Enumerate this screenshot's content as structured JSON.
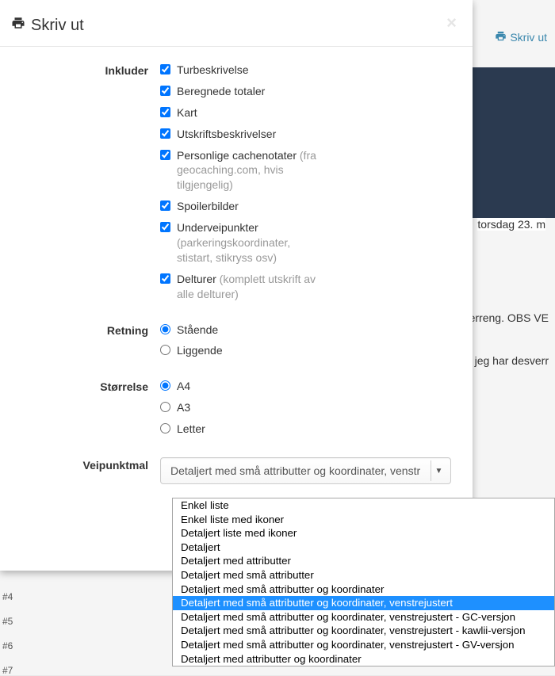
{
  "modal": {
    "title": "Skriv ut",
    "close": "×"
  },
  "background": {
    "print_link": "Skriv ut",
    "date": "torsdag 23. m",
    "text1": "terreng. OBS VE",
    "text2": ", jeg har desverr",
    "rows": [
      "#4",
      "#5",
      "#6",
      "#7"
    ]
  },
  "sections": {
    "include": {
      "label": "Inkluder",
      "items": [
        {
          "label": "Turbeskrivelse",
          "checked": true
        },
        {
          "label": "Beregnede totaler",
          "checked": true
        },
        {
          "label": "Kart",
          "checked": true
        },
        {
          "label": "Utskriftsbeskrivelser",
          "checked": true
        },
        {
          "label": "Personlige cachenotater",
          "hint": " (fra geocaching.com, hvis tilgjengelig)",
          "checked": true
        },
        {
          "label": "Spoilerbilder",
          "checked": true
        },
        {
          "label": "Underveipunkter",
          "hint": " (parkeringskoordinater, stistart, stikryss osv)",
          "checked": true
        },
        {
          "label": "Delturer",
          "hint": " (komplett utskrift av alle delturer)",
          "checked": true
        }
      ]
    },
    "orientation": {
      "label": "Retning",
      "items": [
        {
          "label": "Stående",
          "checked": true
        },
        {
          "label": "Liggende",
          "checked": false
        }
      ]
    },
    "size": {
      "label": "Størrelse",
      "items": [
        {
          "label": "A4",
          "checked": true
        },
        {
          "label": "A3",
          "checked": false
        },
        {
          "label": "Letter",
          "checked": false
        }
      ]
    },
    "template": {
      "label": "Veipunktmal",
      "selected_text": "Detaljert med små attributter og koordinater, venstr",
      "options": [
        "Enkel liste",
        "Enkel liste med ikoner",
        "Detaljert liste med ikoner",
        "Detaljert",
        "Detaljert med attributter",
        "Detaljert med små attributter",
        "Detaljert med små attributter og koordinater",
        "Detaljert med små attributter og koordinater, venstrejustert",
        "Detaljert med små attributter og koordinater, venstrejustert - GC-versjon",
        "Detaljert med små attributter og koordinater, venstrejustert - kawlii-versjon",
        "Detaljert med små attributter og koordinater, venstrejustert - GV-versjon",
        "Detaljert med attributter og koordinater"
      ],
      "selected_index": 7
    }
  }
}
